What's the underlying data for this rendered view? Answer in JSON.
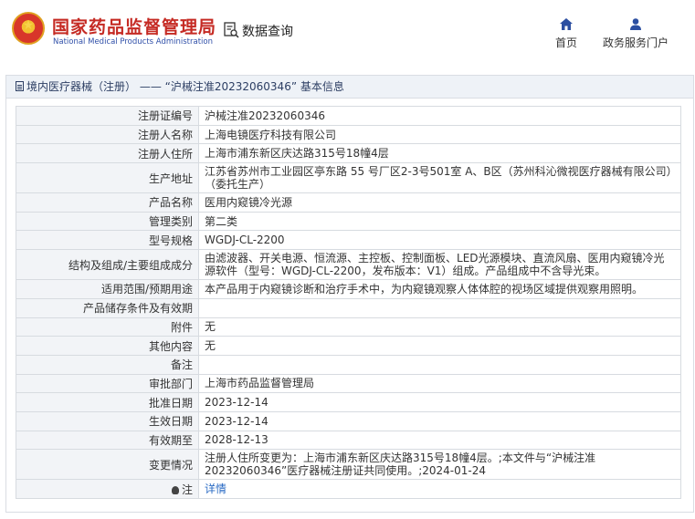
{
  "header": {
    "site_title": "国家药品监督管理局",
    "site_subtitle": "National Medical Products Administration",
    "query_label": "数据查询",
    "nav": [
      {
        "label": "首页",
        "icon": "home-icon"
      },
      {
        "label": "政务服务门户",
        "icon": "user-icon"
      }
    ]
  },
  "panel": {
    "title": "境内医疗器械（注册） —— “沪械注准20232060346” 基本信息"
  },
  "rows": [
    {
      "label": "注册证编号",
      "value": "沪械注准20232060346"
    },
    {
      "label": "注册人名称",
      "value": "上海电镜医疗科技有限公司"
    },
    {
      "label": "注册人住所",
      "value": "上海市浦东新区庆达路315号18幢4层"
    },
    {
      "label": "生产地址",
      "value": "江苏省苏州市工业园区亭东路 55 号厂区2-3号501室 A、B区（苏州科沁微视医疗器械有限公司）（委托生产）"
    },
    {
      "label": "产品名称",
      "value": "医用内窥镜冷光源"
    },
    {
      "label": "管理类别",
      "value": "第二类"
    },
    {
      "label": "型号规格",
      "value": "WGDJ-CL-2200"
    },
    {
      "label": "结构及组成/主要组成成分",
      "value": "由滤波器、开关电源、恒流源、主控板、控制面板、LED光源模块、直流风扇、医用内窥镜冷光源软件（型号：WGDJ-CL-2200，发布版本：V1）组成。产品组成中不含导光束。"
    },
    {
      "label": "适用范围/预期用途",
      "value": "本产品用于内窥镜诊断和治疗手术中，为内窥镜观察人体体腔的视场区域提供观察用照明。"
    },
    {
      "label": "产品储存条件及有效期",
      "value": ""
    },
    {
      "label": "附件",
      "value": "无"
    },
    {
      "label": "其他内容",
      "value": "无"
    },
    {
      "label": "备注",
      "value": ""
    },
    {
      "label": "审批部门",
      "value": "上海市药品监督管理局"
    },
    {
      "label": "批准日期",
      "value": "2023-12-14"
    },
    {
      "label": "生效日期",
      "value": "2023-12-14"
    },
    {
      "label": "有效期至",
      "value": "2028-12-13"
    },
    {
      "label": "变更情况",
      "value": "注册人住所变更为：上海市浦东新区庆达路315号18幢4层。;本文件与“沪械注准20232060346”医疗器械注册证共同使用。;2024-01-24"
    },
    {
      "label": "注",
      "value": "详情"
    }
  ],
  "colors": {
    "brand_red": "#c52a23",
    "link_blue": "#2a6bc4",
    "label_bg": "#f2f4f7"
  }
}
